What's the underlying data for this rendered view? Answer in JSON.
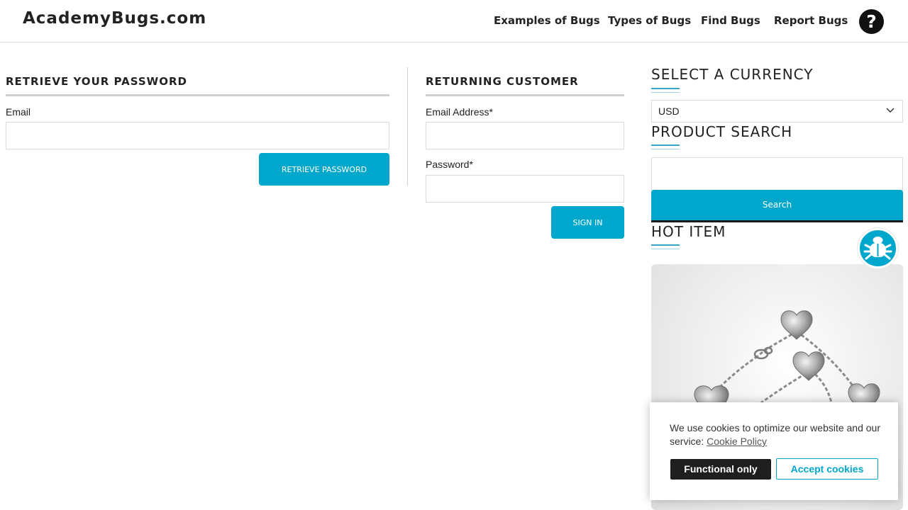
{
  "header": {
    "logo": "AcademyBugs.com",
    "nav": [
      "Examples of Bugs",
      "Types of Bugs",
      "Find Bugs",
      "Report Bugs"
    ],
    "help_icon_glyph": "?"
  },
  "retrieve": {
    "title": "RETRIEVE YOUR PASSWORD",
    "email_label": "Email",
    "email_value": "",
    "button": "RETRIEVE PASSWORD"
  },
  "login": {
    "title": "RETURNING CUSTOMER",
    "email_label": "Email Address*",
    "email_value": "",
    "password_label": "Password*",
    "password_value": "",
    "button": "SIGN IN"
  },
  "sidebar": {
    "currency_title": "SELECT A CURRENCY",
    "currency_selected": "USD",
    "search_title": "PRODUCT SEARCH",
    "search_value": "",
    "search_button": "Search",
    "hot_title": "HOT ITEM"
  },
  "cookie": {
    "text": "We use cookies to optimize our website and our service:",
    "link": "Cookie Policy",
    "functional": "Functional only",
    "accept": "Accept cookies"
  },
  "colors": {
    "accent": "#00a7cc",
    "dark": "#1e1e1e"
  }
}
